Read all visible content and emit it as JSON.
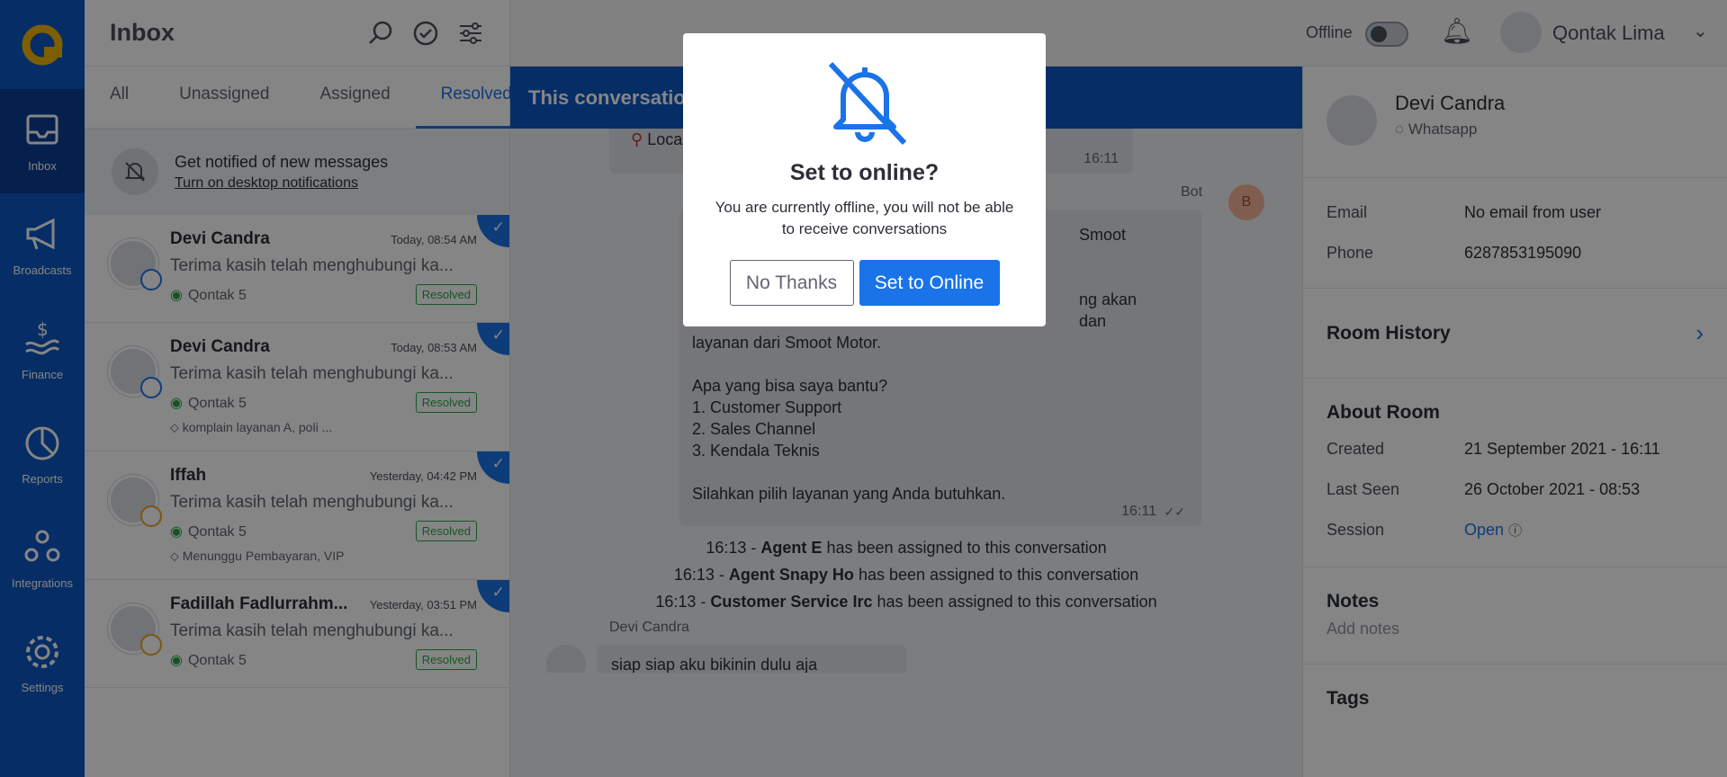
{
  "rail": {
    "items": [
      {
        "label": "Inbox",
        "icon": "inbox-icon"
      },
      {
        "label": "Broadcasts",
        "icon": "megaphone-icon"
      },
      {
        "label": "Finance",
        "icon": "finance-icon"
      },
      {
        "label": "Reports",
        "icon": "pie-chart-icon"
      },
      {
        "label": "Integrations",
        "icon": "integrations-icon"
      },
      {
        "label": "Settings",
        "icon": "gear-icon"
      }
    ]
  },
  "inbox": {
    "title": "Inbox",
    "tabs": [
      "All",
      "Unassigned",
      "Assigned",
      "Resolved"
    ],
    "active_tab": "Resolved",
    "notif_title": "Get notified of new messages",
    "notif_link": "Turn on desktop notifications",
    "conversations": [
      {
        "name": "Devi Candra",
        "time": "Today, 08:54 AM",
        "preview": "Terima kasih telah menghubungi ka...",
        "channel": "Qontak 5",
        "status": "Resolved",
        "tags": ""
      },
      {
        "name": "Devi Candra",
        "time": "Today, 08:53 AM",
        "preview": "Terima kasih telah menghubungi ka...",
        "channel": "Qontak 5",
        "status": "Resolved",
        "tags": "komplain layanan A, poli ..."
      },
      {
        "name": "Iffah",
        "time": "Yesterday, 04:42 PM",
        "preview": "Terima kasih telah menghubungi ka...",
        "channel": "Qontak 5",
        "status": "Resolved",
        "tags": "Menunggu Pembayaran, VIP"
      },
      {
        "name": "Fadillah Fadlurrahm...",
        "time": "Yesterday, 03:51 PM",
        "preview": "Terima kasih telah menghubungi ka...",
        "channel": "Qontak 5",
        "status": "Resolved",
        "tags": ""
      }
    ]
  },
  "topbar": {
    "status_label": "Offline",
    "user_name": "Qontak Lima"
  },
  "chat": {
    "header": "This conversation",
    "location_label": "Loca",
    "loc_time": "16:11",
    "bot_label": "Bot",
    "bot_avatar": "B",
    "bot_lines": [
      "Smoot",
      "ng akan",
      "dan",
      "layanan dari Smoot Motor.",
      "",
      "Apa yang bisa saya bantu?",
      "1. Customer Support",
      "2. Sales Channel",
      "3. Kendala Teknis",
      "",
      "Silahkan pilih layanan yang Anda butuhkan."
    ],
    "bot_time": "16:11",
    "system": [
      {
        "time": "16:13 -",
        "agent": "Agent E",
        "text": "has been assigned to this conversation"
      },
      {
        "time": "16:13 -",
        "agent": "Agent Snapy Ho",
        "text": "has been assigned to this conversation"
      },
      {
        "time": "16:13 -",
        "agent": "Customer Service Irc",
        "text": "has been assigned to this conversation"
      }
    ],
    "customer_name": "Devi Candra",
    "customer_msg": "siap siap aku bikinin dulu aja"
  },
  "contact": {
    "name": "Devi Candra",
    "channel": "Whatsapp",
    "email_label": "Email",
    "email": "No email from user",
    "phone_label": "Phone",
    "phone": "6287853195090",
    "room_history": "Room History",
    "about_room": "About Room",
    "created_label": "Created",
    "created": "21 September 2021 - 16:11",
    "last_seen_label": "Last Seen",
    "last_seen": "26 October 2021 - 08:53",
    "session_label": "Session",
    "session": "Open",
    "notes": "Notes",
    "add_notes": "Add notes",
    "tags": "Tags"
  },
  "modal": {
    "title": "Set to online?",
    "description": "You are currently offline, you will not be able to receive conversations",
    "no_label": "No Thanks",
    "yes_label": "Set to Online"
  },
  "colors": {
    "brand": "#0d56c1",
    "accent": "#1a73e8",
    "resolved": "#27a845",
    "logo": "#f0b400"
  }
}
